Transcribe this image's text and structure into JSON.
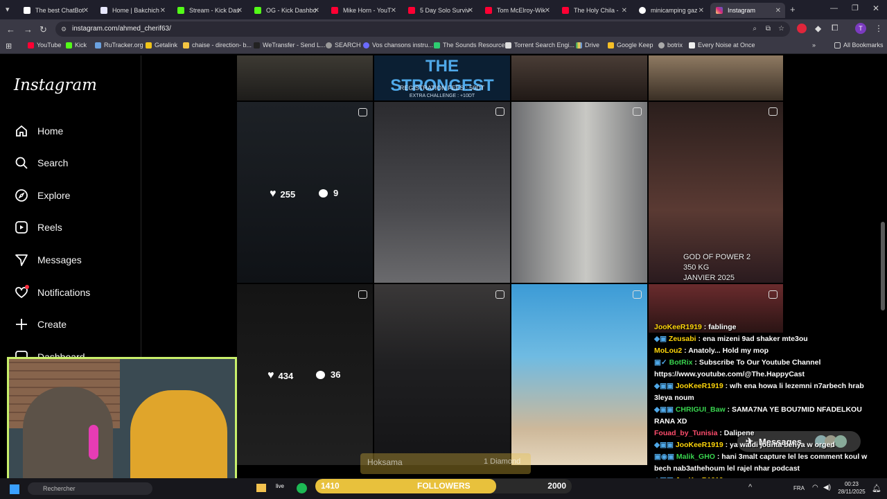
{
  "browser": {
    "tabs": [
      {
        "label": "The best ChatBot"
      },
      {
        "label": "Home | Bakchich"
      },
      {
        "label": "Stream - Kick Das"
      },
      {
        "label": "OG - Kick Dashbo"
      },
      {
        "label": "Mike Horn - YouT"
      },
      {
        "label": "5 Day Solo Surviv"
      },
      {
        "label": "Tom McElroy-Wik"
      },
      {
        "label": "The Holy Chila -"
      },
      {
        "label": "minicamping gaz"
      },
      {
        "label": "Instagram"
      }
    ],
    "url": "instagram.com/ahmed_cherif63/",
    "bookmarks": [
      "YouTube",
      "Kick",
      "RuTracker.org",
      "Getalink",
      "chaise - direction- b...",
      "WeTransfer - Send L...",
      "SEARCH",
      "Vos chansons instru...",
      "The Sounds Resource",
      "Torrent Search Engi...",
      "Drive",
      "Google Keep",
      "botrix",
      "Every Noise at Once"
    ],
    "all_bookmarks": "All Bookmarks"
  },
  "instagram": {
    "logo": "Instagram",
    "nav": [
      {
        "label": "Home",
        "icon": "home-icon"
      },
      {
        "label": "Search",
        "icon": "search-icon"
      },
      {
        "label": "Explore",
        "icon": "compass-icon"
      },
      {
        "label": "Reels",
        "icon": "reels-icon"
      },
      {
        "label": "Messages",
        "icon": "messages-icon"
      },
      {
        "label": "Notifications",
        "icon": "heart-icon"
      },
      {
        "label": "Create",
        "icon": "plus-icon"
      },
      {
        "label": "Dashboard",
        "icon": "dashboard-icon"
      }
    ],
    "poster": {
      "title": "THE STRONGEST",
      "fees": "REGISTRATION FEES : 50DT",
      "extra": "EXTRA CHALLENGE : +10DT"
    },
    "post1": {
      "likes": "255",
      "comments": "9"
    },
    "post2": {
      "likes": "434",
      "comments": "36"
    },
    "post_caption": [
      "GOD OF POWER 2",
      "350 KG",
      "JANVIER 2025"
    ],
    "messages_label": "Messages"
  },
  "chat": [
    {
      "user": "JooKeeR1919",
      "msg": " : fablinge"
    },
    {
      "user": "Zeusabi",
      "msg": " : ena mizeni 9ad shaker mte3ou"
    },
    {
      "user": "MoLou2",
      "msg": " : Anatoly... Hold my mop"
    },
    {
      "user": "BotRix",
      "msg": " : Subscribe To Our Youtube Channel https://www.youtube.com/@The.HappyCast"
    },
    {
      "user": "JooKeeR1919",
      "msg": " : w/h ena howa li lezemni n7arbech hrab 3leya noum"
    },
    {
      "user": "CHRIGUI_Baw",
      "msg": " : SAMA7NA YE BOU7MID NFADELKOU RANA XD"
    },
    {
      "user": "Fouad_by_Tunisia",
      "msg": " : Dalipene"
    },
    {
      "user": "JooKeeR1919",
      "msg": " : ya waldi jounta behya w orged"
    },
    {
      "user": "Malik_GHO",
      "msg": " : hani 3malt capture lel les comment koul w bech nab3athehoum lel rajel nhar podcast"
    },
    {
      "user": "JooKeeR1919",
      "msg": " :"
    }
  ],
  "hoksama": {
    "left": "Hoksama",
    "right": "1 Diamond"
  },
  "followers": {
    "current": "1410",
    "label": "FOLLOWERS",
    "goal": "2000",
    "progress": 0.705
  },
  "taskbar": {
    "search": "Rechercher",
    "lang": "FRA",
    "time": "00:23",
    "date": "28/11/2025"
  },
  "colors": {
    "accent_instagram": "#ff3040",
    "followers_bar": "#e8c13c",
    "cam_border": "#c9f06b"
  }
}
